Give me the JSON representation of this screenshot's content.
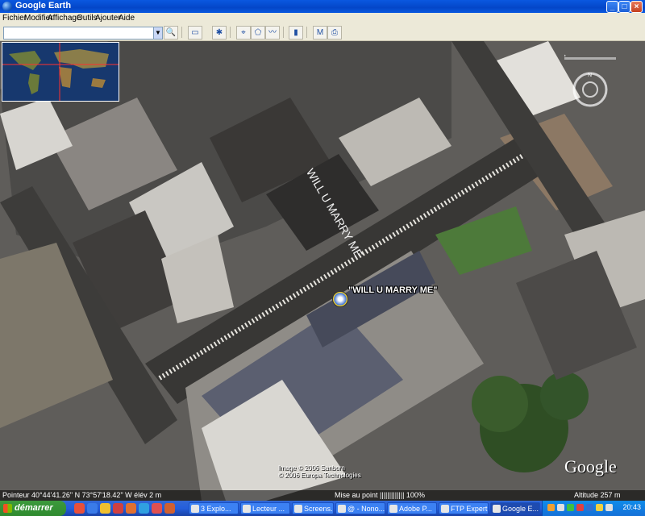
{
  "window": {
    "title": "Google Earth"
  },
  "menu": [
    "Fichier",
    "Modifier",
    "Affichage",
    "Outils",
    "Ajouter",
    "Aide"
  ],
  "search": {
    "value": "",
    "placeholder": ""
  },
  "placemark": {
    "label": "\"WILL U MARRY ME\""
  },
  "rooftop_text": "WILL U MARRY ME",
  "credits": [
    "Image © 2006 Sanborn",
    "© 2006 Europa Technologies"
  ],
  "logo": "Google",
  "status": {
    "pointer": "Pointeur 40°44'41.26\" N    73°57'18.42\" W   élév   2 m",
    "streaming": "Mise au point ||||||||||||| 100%",
    "altitude": "Altitude      257 m"
  },
  "taskbar": {
    "start": "démarrer",
    "tasks": [
      {
        "label": "3 Explo..."
      },
      {
        "label": "Lecteur ..."
      },
      {
        "label": "Screens..."
      },
      {
        "label": "@ - Nono..."
      },
      {
        "label": "Adobe P..."
      },
      {
        "label": "FTP Expert"
      },
      {
        "label": "Google E..."
      }
    ],
    "clock": "20:43"
  },
  "colors": {
    "titlebar": "#0a58e0",
    "taskbar": "#245edc",
    "start": "#3c9a3c",
    "placemark_ring": "#f0d030"
  }
}
